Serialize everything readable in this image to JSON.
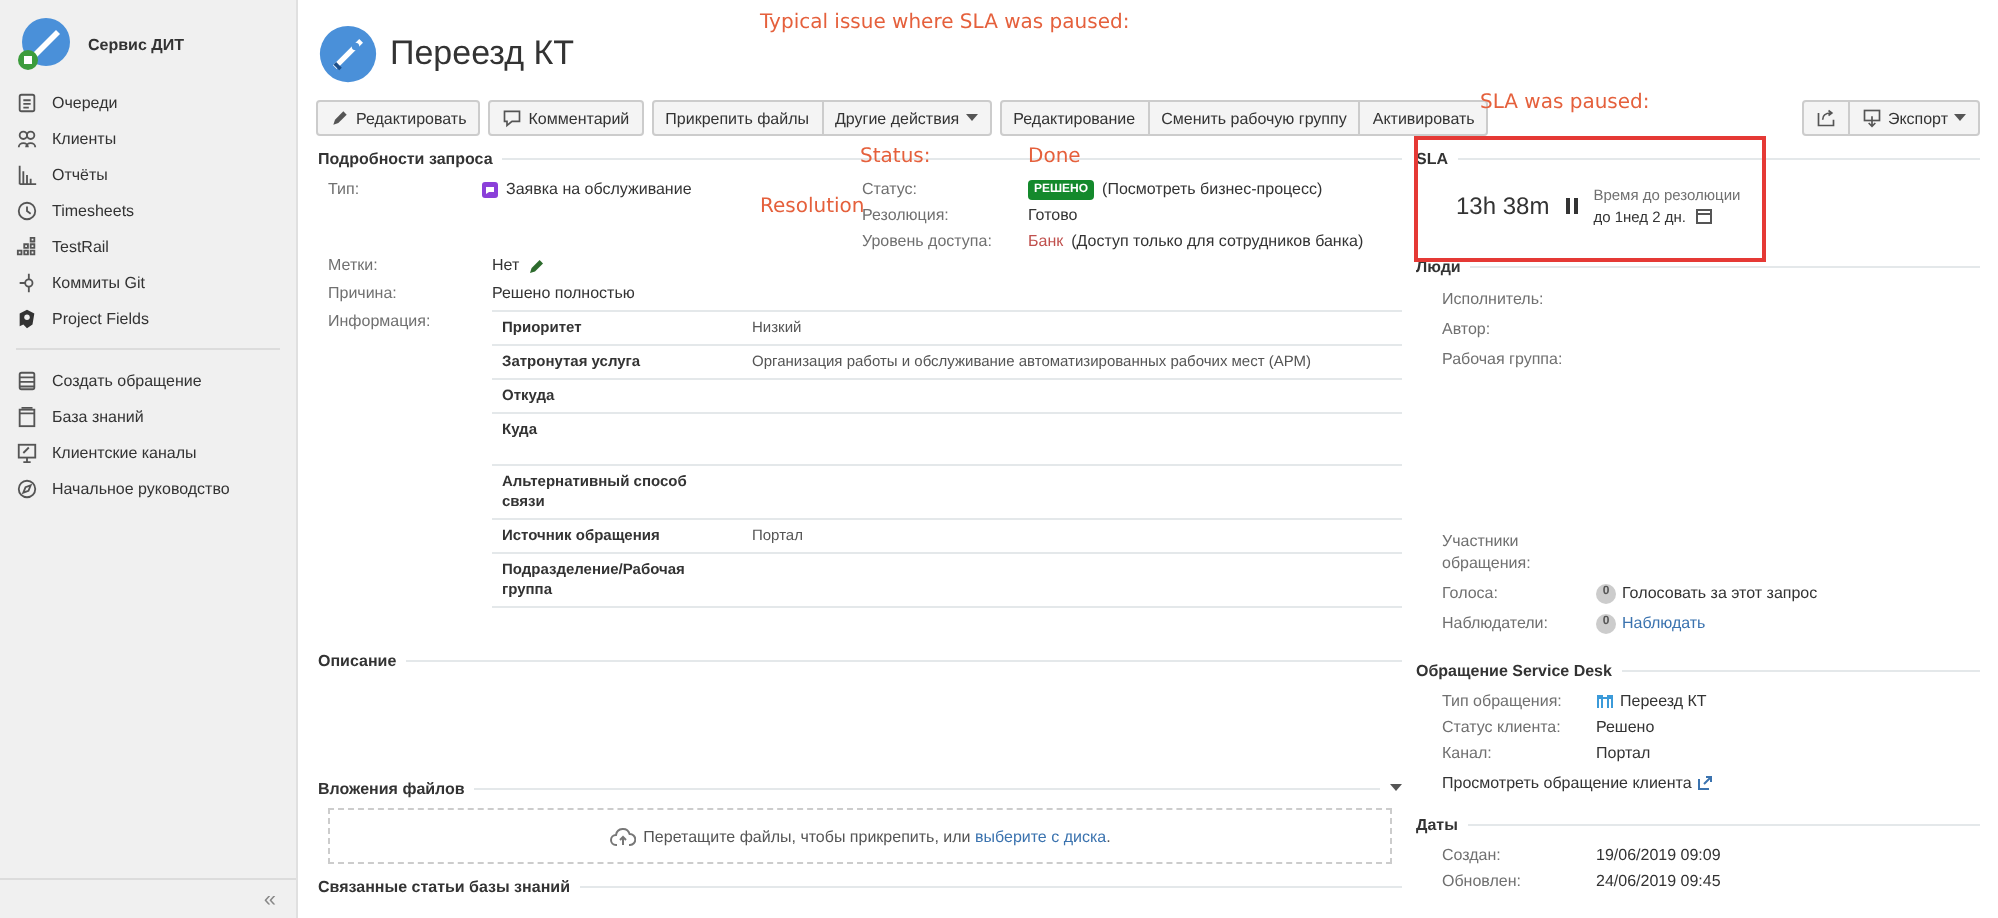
{
  "sidebar": {
    "project": "Сервис ДИТ",
    "items": [
      {
        "label": "Очереди"
      },
      {
        "label": "Клиенты"
      },
      {
        "label": "Отчёты"
      },
      {
        "label": "Timesheets"
      },
      {
        "label": "TestRail"
      },
      {
        "label": "Коммиты Git"
      },
      {
        "label": "Project Fields"
      }
    ],
    "links": [
      {
        "label": "Создать обращение"
      },
      {
        "label": "База знаний"
      },
      {
        "label": "Клиентские каналы"
      },
      {
        "label": "Начальное руководство"
      }
    ],
    "collapse": "«"
  },
  "issue_title": "Переезд КТ",
  "toolbar": [
    [
      {
        "label": "Редактировать"
      }
    ],
    [
      {
        "label": "Комментарий"
      }
    ],
    [
      {
        "label": "Прикрепить файлы"
      },
      {
        "label": "Другие действия"
      }
    ],
    [
      {
        "label": "Редактирование"
      },
      {
        "label": "Сменить рабочую группу"
      },
      {
        "label": "Активировать"
      }
    ]
  ],
  "export_button": "Экспорт",
  "details": {
    "heading": "Подробности запроса",
    "type": {
      "label": "Тип:",
      "value": "Заявка на обслуживание"
    },
    "status": {
      "label": "Статус:",
      "badge": "РЕШЕНО",
      "link": "(Посмотреть бизнес-процесс)"
    },
    "resolution": {
      "label": "Резолюция:",
      "value": "Готово"
    },
    "access": {
      "label": "Уровень доступа:",
      "link": "Банк",
      "value": "(Доступ только для сотрудников банка)"
    },
    "tags": {
      "label": "Метки:",
      "value": "Нет"
    },
    "reason": {
      "label": "Причина:",
      "value": "Решено полностью"
    },
    "info": {
      "label": "Информация:",
      "rows": [
        {
          "name": "Приоритет",
          "value": "Низкий"
        },
        {
          "name": "Затронутая услуга",
          "value": "Организация работы и обслуживание автоматизированных рабочих мест (АРМ)"
        },
        {
          "name": "Откуда"
        },
        {
          "name": "Куда"
        },
        {
          "name": "Альтернативный способ связи"
        },
        {
          "name": "Источник обращения",
          "value": "Портал"
        },
        {
          "name": "Подразделение/Рабочая группа"
        }
      ]
    }
  },
  "description": {
    "heading": "Описание"
  },
  "attachments": {
    "heading": "Вложения файлов",
    "drop_text": "Перетащите файлы, чтобы прикрепить, или",
    "drop_link": "выберите с диска",
    "drop_end": "."
  },
  "related": {
    "heading": "Связанные статьи базы знаний"
  },
  "sla": {
    "heading": "SLA",
    "time": "13h 38m",
    "paused": true,
    "goal": "Время до резолюции",
    "target": "до 1нед 2 дн."
  },
  "people": {
    "heading": "Люди",
    "fields": [
      {
        "label": "Исполнитель:"
      },
      {
        "label": "Автор:"
      },
      {
        "label": "Рабочая группа:"
      }
    ],
    "participants": "Участники обращения:",
    "votes": {
      "label": "Голоса:",
      "count": "0",
      "action": "Голосовать за этот запрос"
    },
    "watchers": {
      "label": "Наблюдатели:",
      "count": "0",
      "action": "Наблюдать"
    }
  },
  "service_desk": {
    "heading": "Обращение Service Desk",
    "fields": [
      {
        "label": "Тип обращения:",
        "value": "Переезд КТ"
      },
      {
        "label": "Статус клиента:",
        "value": "Решено"
      },
      {
        "label": "Канал:",
        "value": "Портал"
      }
    ],
    "link": "Просмотреть обращение клиента"
  },
  "dates": {
    "heading": "Даты",
    "fields": [
      {
        "label": "Создан:",
        "value": "19/06/2019 09:09"
      },
      {
        "label": "Обновлен:",
        "value": "24/06/2019 09:45"
      }
    ]
  },
  "annotations": [
    {
      "text": "Typical issue where SLA was paused:"
    },
    {
      "text": "Status:"
    },
    {
      "text": "Done"
    },
    {
      "text": "Resolution"
    },
    {
      "text": "SLA was paused:"
    }
  ]
}
